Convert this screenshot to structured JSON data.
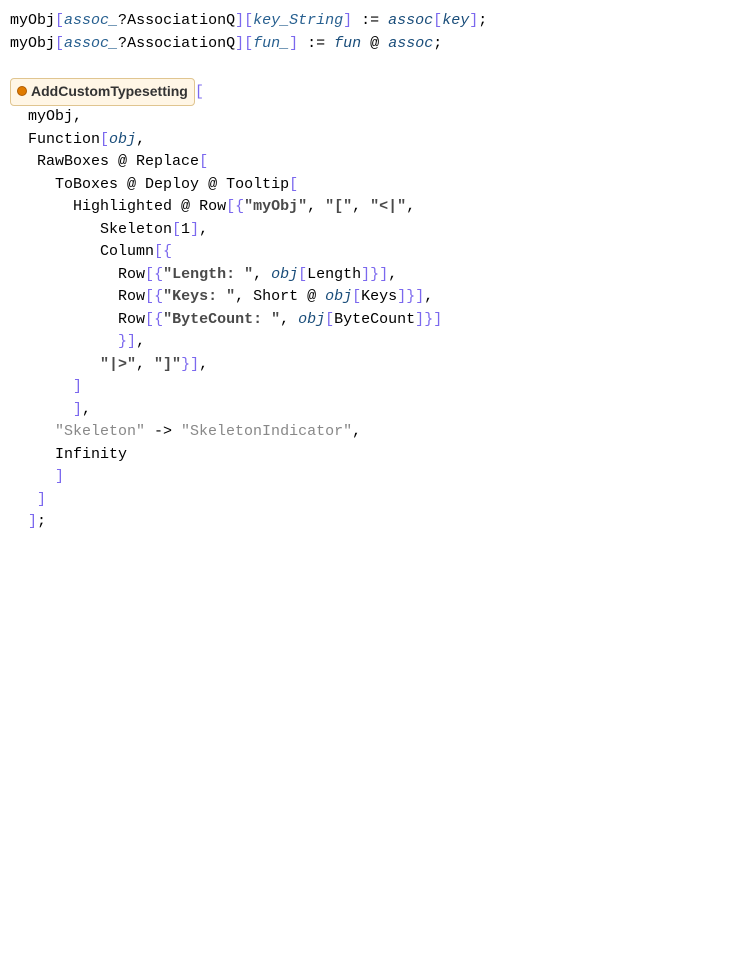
{
  "def1": {
    "head": "myObj",
    "param1": "assoc_",
    "qmark": "?",
    "assocQ": "AssociationQ",
    "lb": "[",
    "param2": "key_String",
    "rb": "]",
    "assign": " := ",
    "rhs1": "assoc",
    "lb2": "[",
    "rhs2": "key",
    "rb2": "]",
    "semi": ";"
  },
  "def2": {
    "head": "myObj",
    "param1": "assoc_",
    "qmark": "?",
    "assocQ": "AssociationQ",
    "lb": "[",
    "param2": "fun_",
    "rb": "]",
    "assign": " := ",
    "rhs1": "fun",
    "at": " @ ",
    "rhs2": "assoc",
    "semi": ";"
  },
  "resource": "AddCustomTypesetting",
  "call": {
    "lb": "[",
    "head": "myObj",
    "comma": ","
  },
  "func": {
    "Function": "Function",
    "lb": "[",
    "obj": "obj",
    "comma": ","
  },
  "rawboxes": {
    "RawBoxes": "RawBoxes",
    "at": " @ ",
    "Replace": "Replace",
    "lb": "["
  },
  "toboxes": {
    "ToBoxes": "ToBoxes",
    "at": " @ ",
    "Deploy": "Deploy",
    "at2": " @ ",
    "Tooltip": "Tooltip",
    "lb": "["
  },
  "havana": {
    "Highlighted": "Highlighted",
    "at": " @ ",
    "Row": "Row",
    "lb": "[",
    "lbrace": "{",
    "str1": "\"myObj\"",
    "comma1": ", ",
    "str2": "\"[\"",
    "comma2": ", ",
    "str3": "\"<|\"",
    "comma3": ","
  },
  "skeleton": {
    "Skeleton": "Skeleton",
    "lb": "[",
    "one": "1",
    "rb": "]",
    "comma": ","
  },
  "col": {
    "Column": "Column",
    "lb": "[",
    "lbrace": "{"
  },
  "row1": {
    "Row": "Row",
    "lb": "[",
    "lbrace": "{",
    "label": "\"Length: \"",
    "comma": ", ",
    "obj": "obj",
    "lb2": "[",
    "fn": "Length",
    "rb2": "]",
    "rbrace": "}",
    "rb": "]",
    "comma2": ","
  },
  "row2": {
    "Row": "Row",
    "lb": "[",
    "lbrace": "{",
    "label": "\"Keys: \"",
    "comma": ", ",
    "Short": "Short",
    "at": " @ ",
    "obj": "obj",
    "lb2": "[",
    "fn": "Keys",
    "rb2": "]",
    "rbrace": "}",
    "rb": "]",
    "comma2": ","
  },
  "row3": {
    "Row": "Row",
    "lb": "[",
    "lbrace": "{",
    "label": "\"ByteCount: \"",
    "comma": ", ",
    "obj": "obj",
    "lb2": "[",
    "fn": "ByteCount",
    "rb2": "]",
    "rbrace": "}",
    "rb": "]"
  },
  "closer1": {
    "rbrace": "}",
    "rb": "]",
    "comma": ","
  },
  "closer2": {
    "str1": "\"|>\"",
    "comma1": ", ",
    "str2": "\"]\"",
    "rbrace": "}",
    "rb": "]",
    "comma2": ","
  },
  "closer3": {
    "rb": "]"
  },
  "closer4": {
    "rb": "]",
    "comma": ","
  },
  "replrule": {
    "str1": "\"Skeleton\"",
    "arrow": " -> ",
    "str2": "\"SkeletonIndicator\"",
    "comma": ","
  },
  "infinity": {
    "Infinity": "Infinity"
  },
  "closing": {
    "rb1": "]",
    "rb2": "]",
    "rb3": "]",
    "rb4": "]",
    "semi": ";"
  }
}
